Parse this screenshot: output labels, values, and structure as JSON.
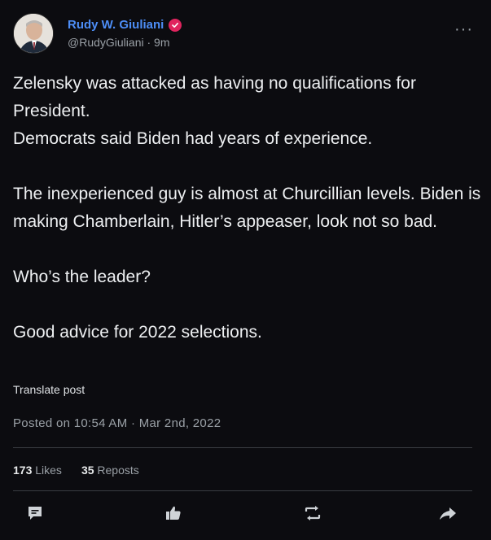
{
  "author": {
    "name": "Rudy W. Giuliani",
    "handle": "@RudyGiuliani",
    "time_ago": "9m",
    "separator": " · "
  },
  "more_label": "···",
  "post": {
    "lines": [
      "Zelensky was attacked as having no qualifications for President.",
      "Democrats said Biden had years of experience.",
      "The inexperienced guy is almost at Churcillian levels. Biden is making Chamberlain, Hitler’s appeaser, look not so bad.",
      "Who’s the leader?",
      "Good advice for 2022 selections."
    ]
  },
  "translate_label": "Translate post",
  "timestamp": "Posted on 10:54 AM · Mar 2nd, 2022",
  "stats": {
    "likes_count": "173",
    "likes_label": "Likes",
    "reposts_count": "35",
    "reposts_label": "Reposts"
  },
  "icons": {
    "comment": "comment-icon",
    "like": "thumbs-up-icon",
    "repost": "repost-icon",
    "share": "share-arrow-icon",
    "verified": "verified-badge-icon"
  },
  "colors": {
    "background": "#0c0c10",
    "name": "#4d8ef7",
    "verified": "#e0245e",
    "text": "#eef0f2",
    "muted": "#9aa0a6"
  }
}
